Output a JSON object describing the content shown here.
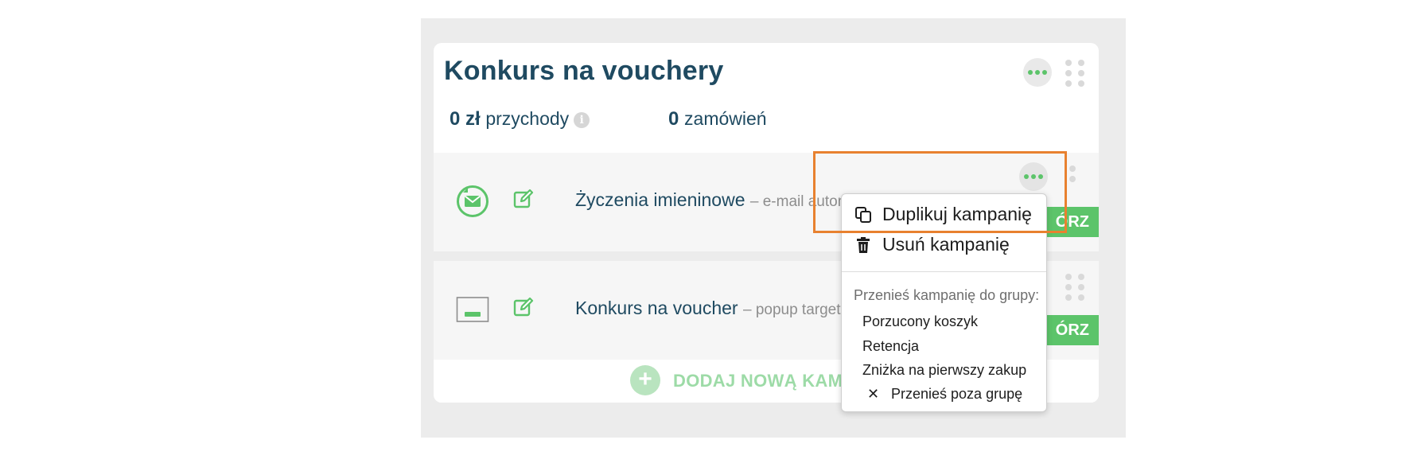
{
  "group": {
    "title": "Konkurs na vouchery",
    "revenue_value": "0 zł",
    "revenue_label": "przychody",
    "orders_value": "0",
    "orders_label": "zamówień"
  },
  "campaigns": [
    {
      "name": "Życzenia imieninowe",
      "type": "– e-mail automa",
      "type_icon": "envelope-autoresponder-icon",
      "button_label": "ÓRZ"
    },
    {
      "name": "Konkurs na voucher",
      "type": "– popup targetow",
      "type_icon": "popup-window-icon",
      "button_label": "ÓRZ"
    }
  ],
  "add_campaign_label": "DODAJ NOWĄ KAMPA",
  "menu": {
    "duplicate_label": "Duplikuj kampanię",
    "delete_label": "Usuń kampanię",
    "move_heading": "Przenieś kampanię do grupy:",
    "groups": [
      "Porzucony koszyk",
      "Retencja",
      "Zniżka na pierwszy zakup"
    ],
    "move_out_label": "Przenieś poza grupę"
  },
  "colors": {
    "accent_green": "#5cc46a",
    "title_navy": "#1f4a61",
    "highlight_orange": "#e8812f"
  }
}
